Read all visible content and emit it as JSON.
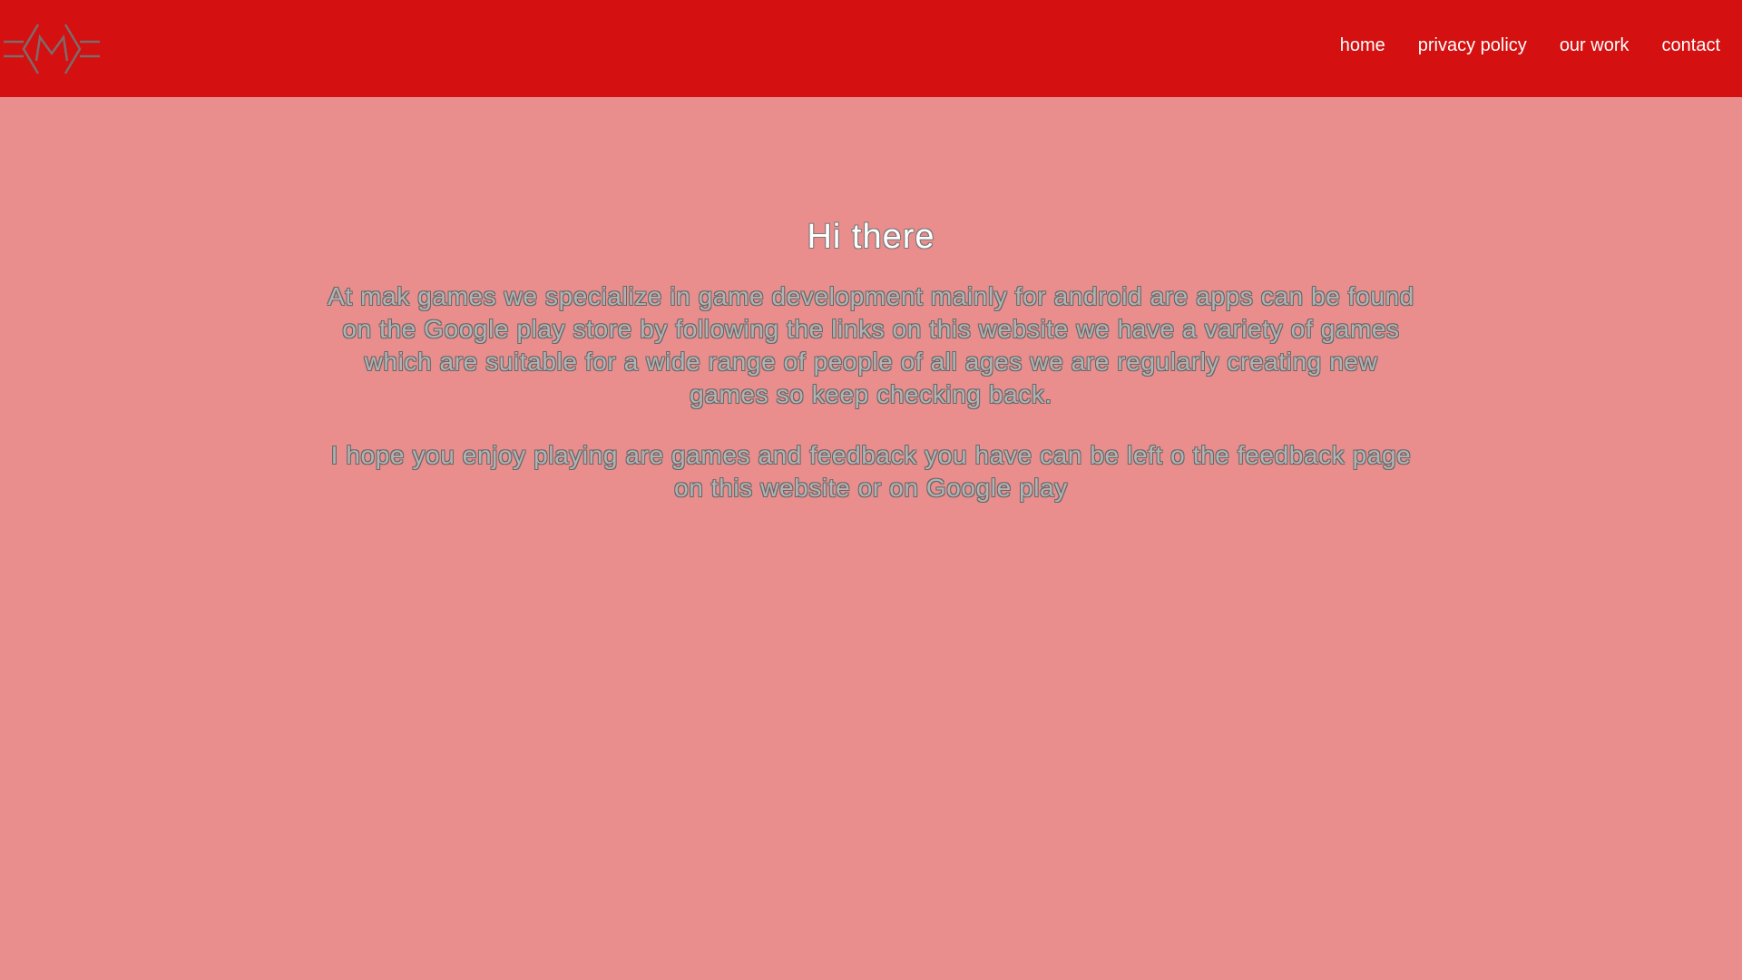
{
  "header": {
    "logo_icon": "m-logo-icon",
    "colors": {
      "header_bg": "#d41010",
      "page_bg": "#e98d8d",
      "nav_text": "#ffffff"
    },
    "nav": [
      {
        "label": "home"
      },
      {
        "label": "privacy policy"
      },
      {
        "label": "our work"
      },
      {
        "label": "contact"
      }
    ]
  },
  "main": {
    "heading": "Hi there",
    "paragraphs": [
      "At mak games we specialize in game development mainly for android are apps can be found on the Google play store by following the links on this website we have a variety of games which are suitable for a wide range of people of all ages we are regularly creating new games so keep checking back.",
      "I hope you enjoy playing are games and feedback you have can be left o the feedback page on this website or on Google play"
    ]
  }
}
